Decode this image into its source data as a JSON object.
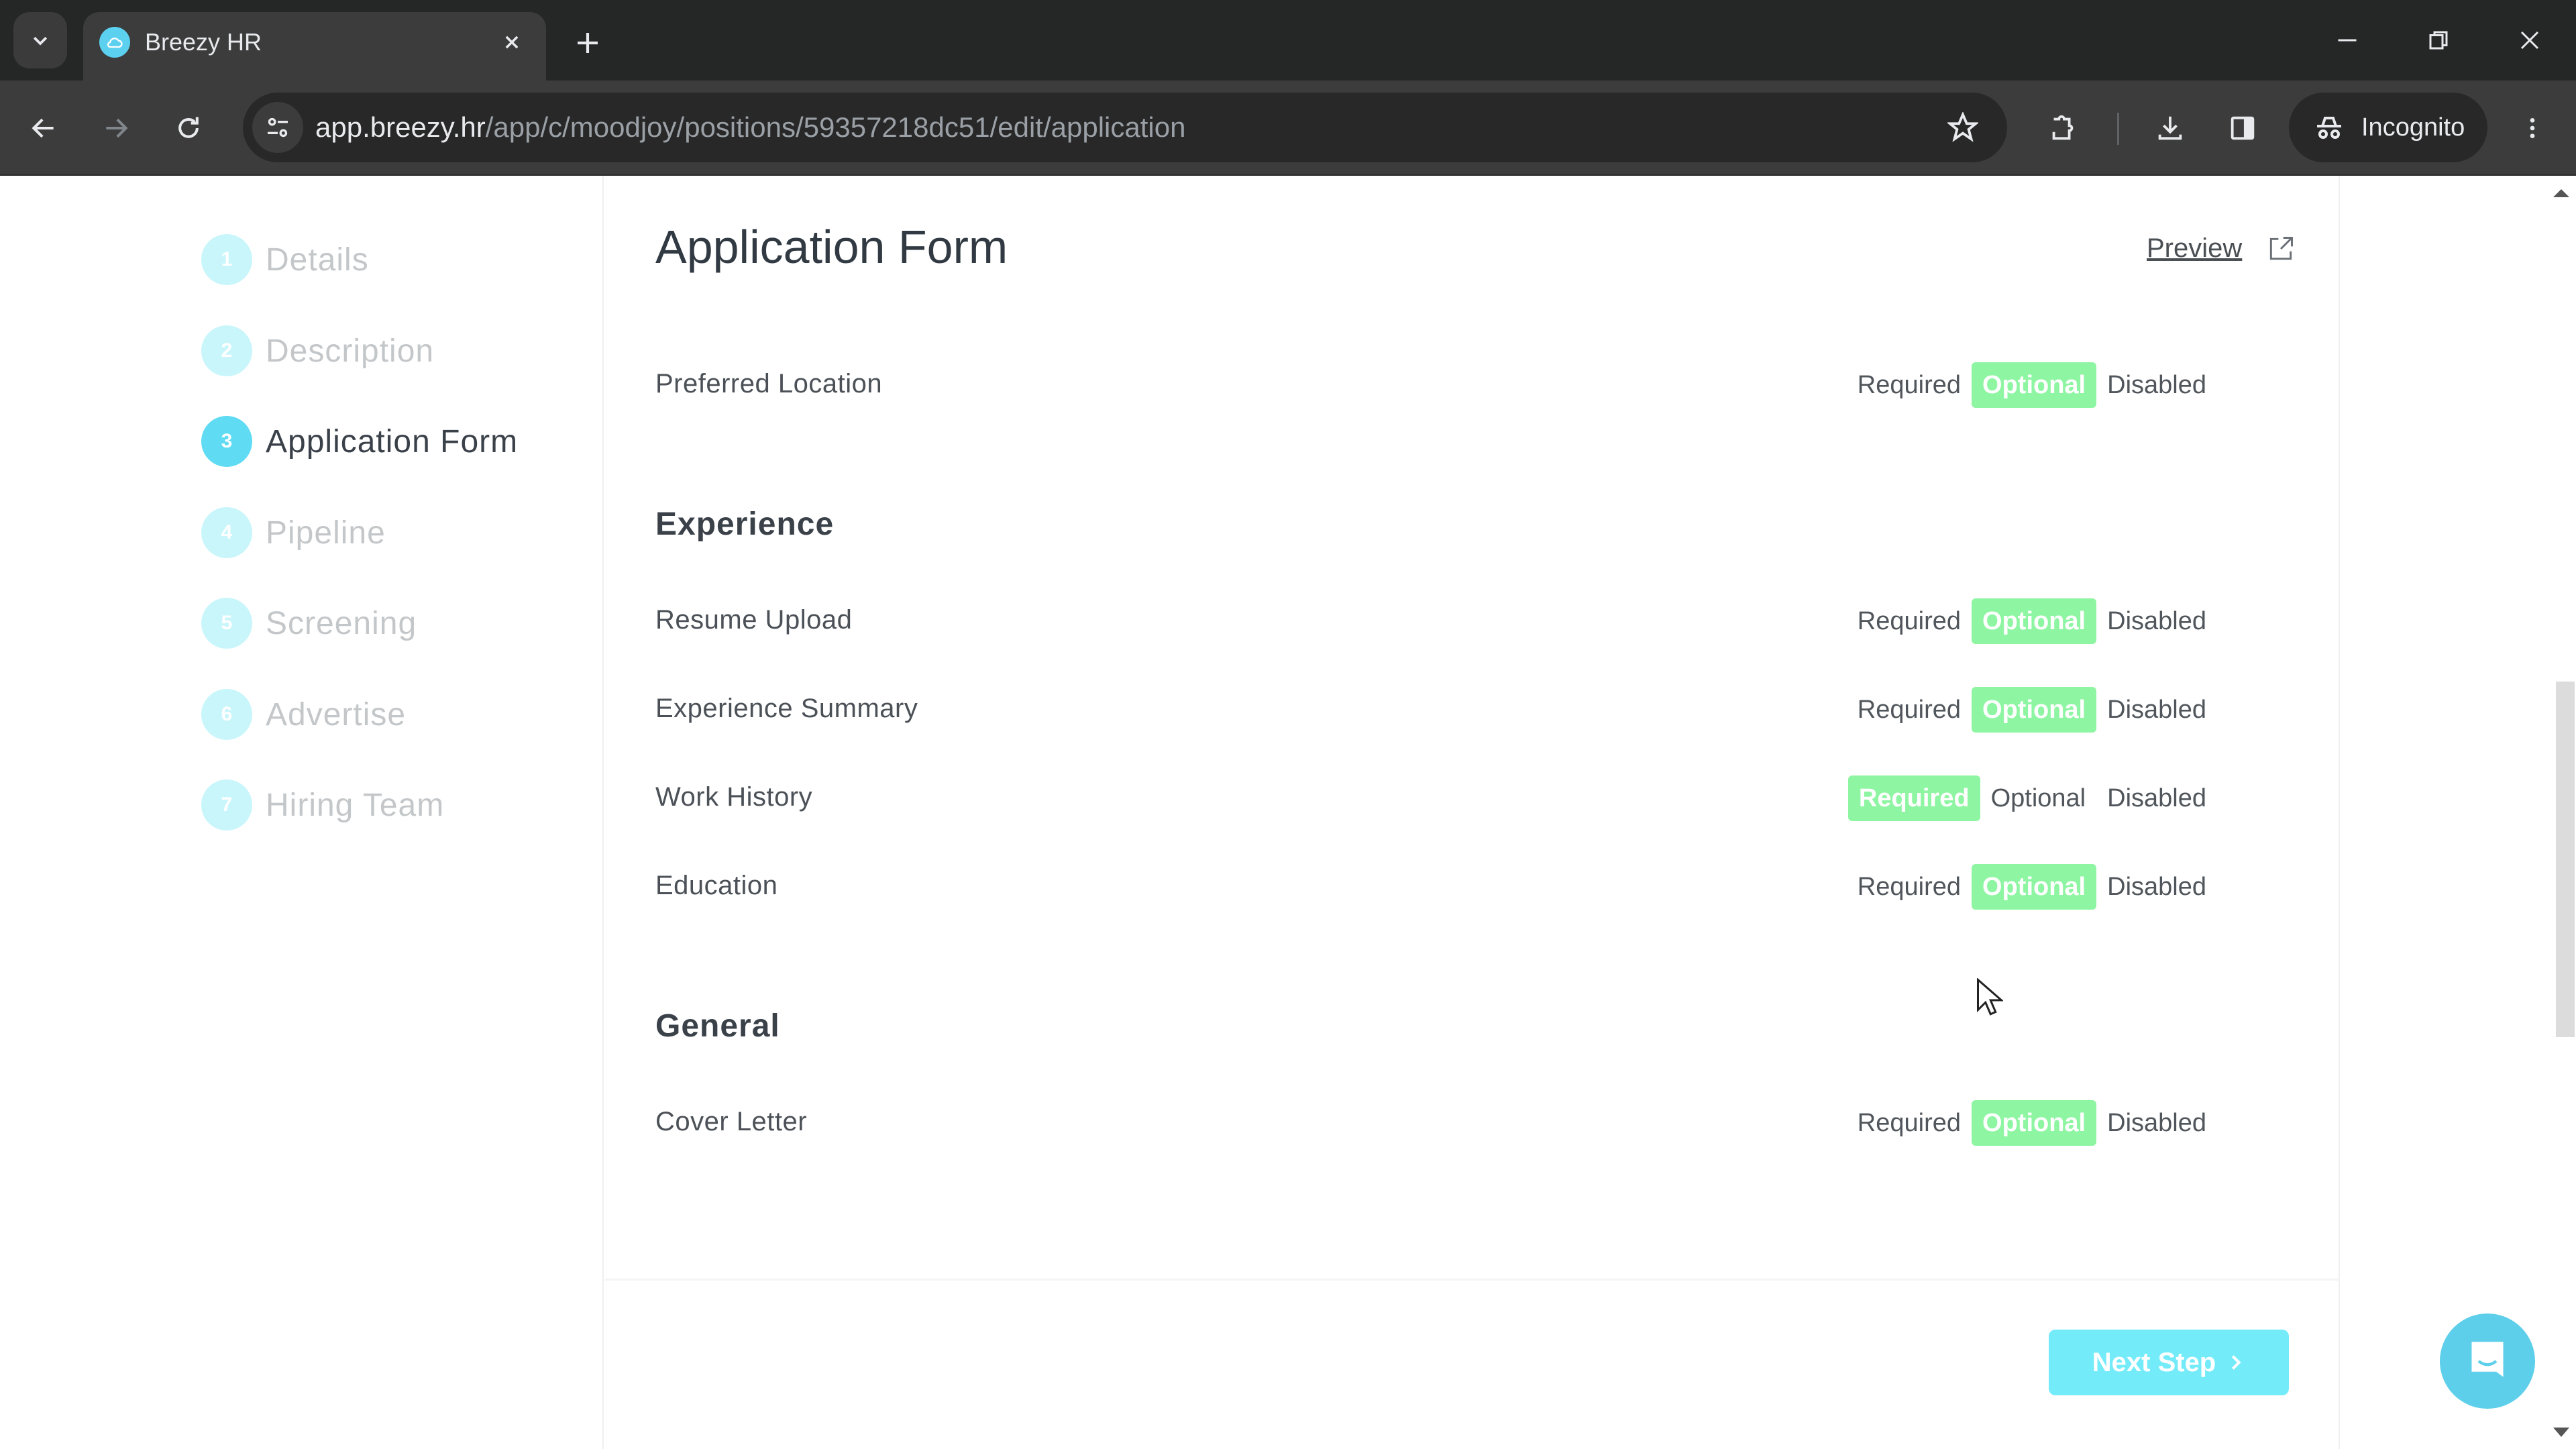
{
  "browser": {
    "tab_title": "Breezy HR",
    "url_host": "app.breezy.hr",
    "url_path": "/app/c/moodjoy/positions/59357218dc51/edit/application",
    "profile_label": "Incognito"
  },
  "sidebar": {
    "steps": [
      {
        "number": "1",
        "label": "Details",
        "active": false
      },
      {
        "number": "2",
        "label": "Description",
        "active": false
      },
      {
        "number": "3",
        "label": "Application Form",
        "active": true
      },
      {
        "number": "4",
        "label": "Pipeline",
        "active": false
      },
      {
        "number": "5",
        "label": "Screening",
        "active": false
      },
      {
        "number": "6",
        "label": "Advertise",
        "active": false
      },
      {
        "number": "7",
        "label": "Hiring Team",
        "active": false
      }
    ]
  },
  "main": {
    "title": "Application Form",
    "preview_label": "Preview",
    "options": [
      "Required",
      "Optional",
      "Disabled"
    ],
    "sections": [
      {
        "title": "",
        "fields": [
          {
            "label": "Preferred Location",
            "selected": "Optional"
          }
        ]
      },
      {
        "title": "Experience",
        "fields": [
          {
            "label": "Resume Upload",
            "selected": "Optional"
          },
          {
            "label": "Experience Summary",
            "selected": "Optional"
          },
          {
            "label": "Work History",
            "selected": "Required"
          },
          {
            "label": "Education",
            "selected": "Optional"
          }
        ]
      },
      {
        "title": "General",
        "fields": [
          {
            "label": "Cover Letter",
            "selected": "Optional"
          }
        ]
      }
    ],
    "next_step_label": "Next Step"
  },
  "scroll": {
    "position_fraction": 0.55,
    "visible_fraction": 0.29
  },
  "colors": {
    "accent_cyan": "#74ebf9",
    "selected_green": "#8ef5a2",
    "step_active": "#5fdbf3",
    "step_inactive": "#c9f6fb",
    "chat_blue": "#5ecfea"
  }
}
